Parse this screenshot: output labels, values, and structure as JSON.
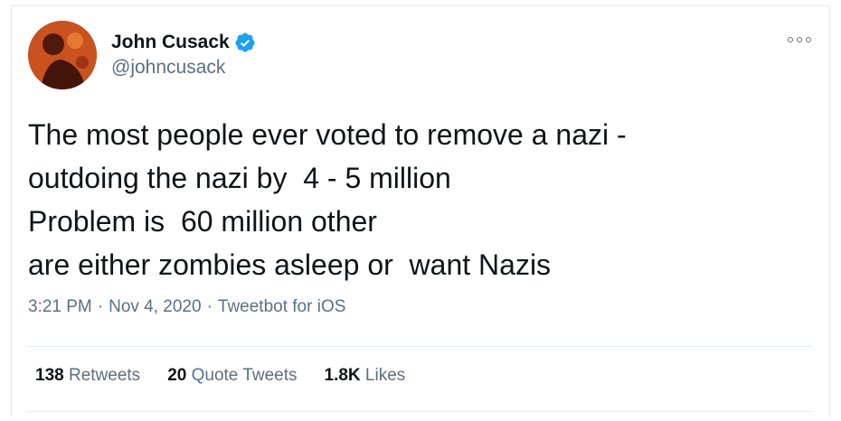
{
  "tweet": {
    "author": {
      "display_name": "John Cusack",
      "handle": "@johncusack",
      "verified": true,
      "avatar_icon": "profile-avatar"
    },
    "more_icon": "more-options-icon",
    "text_lines": [
      "The most people ever voted to remove a nazi -",
      "outdoing the nazi by  4 - 5 million",
      "Problem is  60 million other",
      "are either zombies asleep or  want Nazis"
    ],
    "meta": {
      "time": "3:21 PM",
      "separator": "·",
      "date": "Nov 4, 2020",
      "source": "Tweetbot for iOS"
    },
    "stats": {
      "retweets": {
        "count": "138",
        "label": "Retweets"
      },
      "quote_tweets": {
        "count": "20",
        "label": "Quote Tweets"
      },
      "likes": {
        "count": "1.8K",
        "label": "Likes"
      }
    },
    "colors": {
      "text": "#0f1419",
      "secondary": "#5b7083",
      "verified": "#1da1f2",
      "border": "#e6ecf0"
    }
  }
}
